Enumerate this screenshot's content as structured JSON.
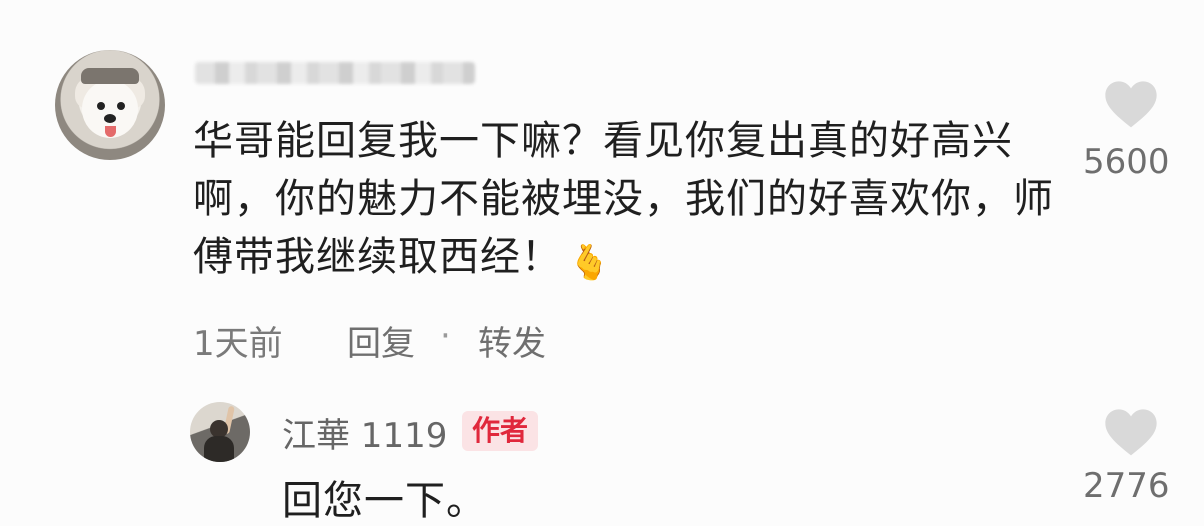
{
  "main_comment": {
    "text": "华哥能回复我一下嘛？看见你复出真的好高兴啊，你的魅力不能被埋没，我们的好喜欢你，师傅带我继续取西经！",
    "emoji": "🫰",
    "time": "1天前",
    "reply_label": "回复",
    "separator": "·",
    "forward_label": "转发",
    "like_count": "5600",
    "like_icon": "heart-icon"
  },
  "reply": {
    "username": "江華 1119",
    "badge": "作者",
    "text": "回您一下。",
    "like_count": "2776",
    "like_icon": "heart-icon"
  },
  "colors": {
    "badge_bg": "#fbe3e5",
    "badge_text": "#e0283c",
    "like_icon": "#d9d9d9"
  }
}
